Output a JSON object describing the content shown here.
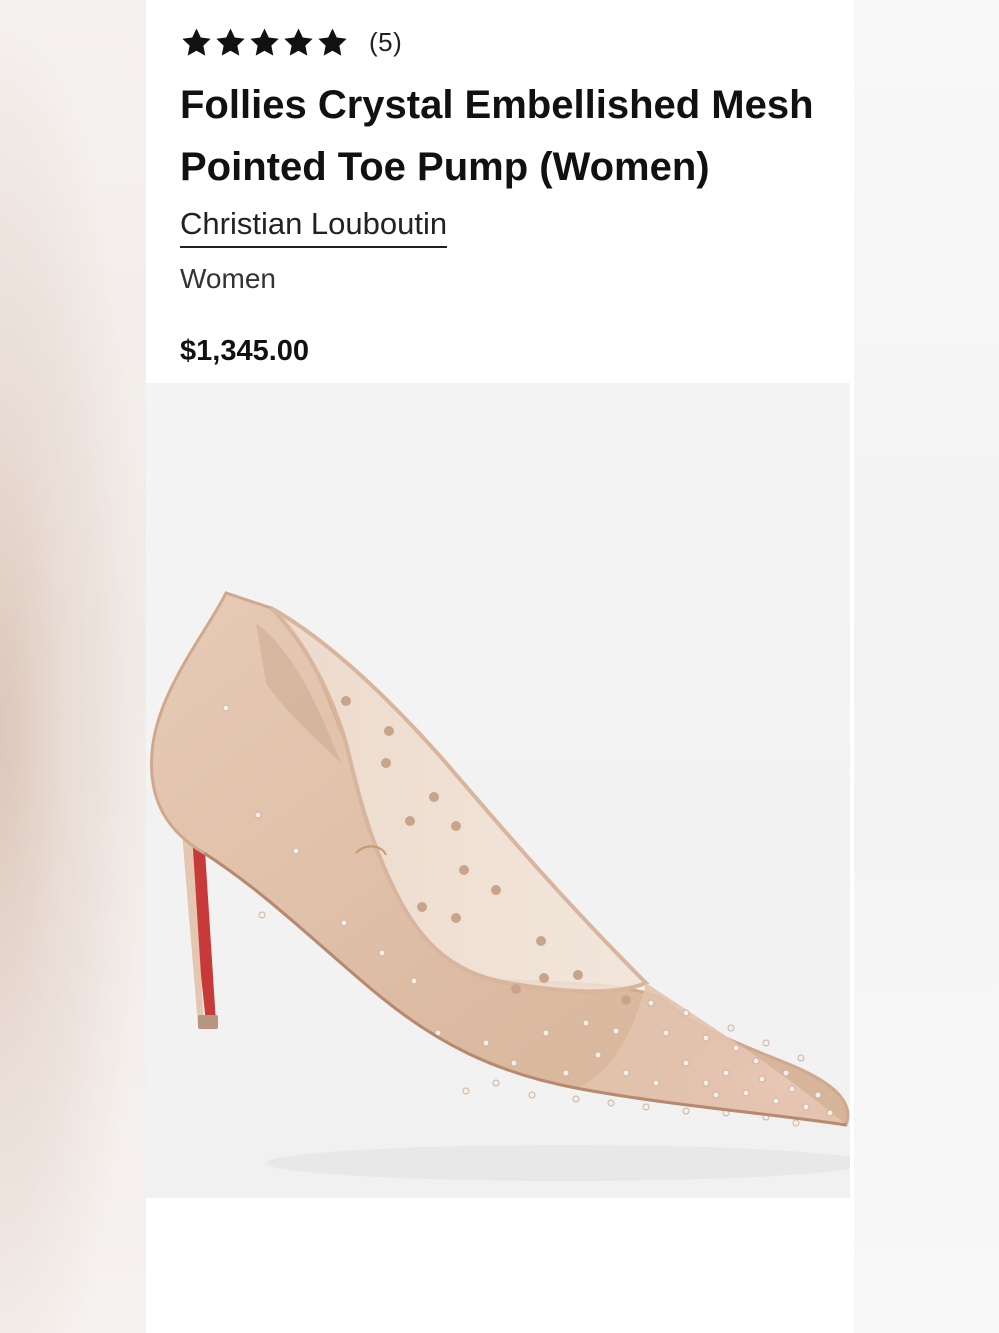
{
  "product": {
    "rating": {
      "stars": 5,
      "count_label": "(5)"
    },
    "title_line1": "Follies Crystal Embellished Mesh",
    "title_line2": "Pointed Toe Pump (Women)",
    "brand": "Christian Louboutin",
    "category": "Women",
    "price": "$1,345.00"
  },
  "colors": {
    "star": "#111111",
    "text": "#111111",
    "image_background": "#f2f2f2",
    "shoe_nude": "#dfc0a8",
    "sole_red": "#c83a3a"
  },
  "image": {
    "semantic": "nude-mesh-crystal-embellished-pump-photo"
  }
}
